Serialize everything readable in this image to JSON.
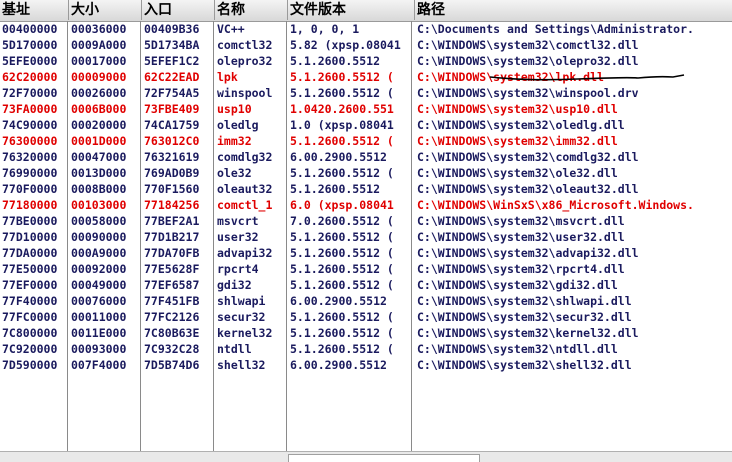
{
  "columns": {
    "base": "基址",
    "size": "大小",
    "entry": "入口",
    "name": "名称",
    "version": "文件版本",
    "path": "路径"
  },
  "modules": [
    {
      "base": "00400000",
      "size": "00036000",
      "entry": "00409B36",
      "name": "VC++",
      "version": "1, 0, 0, 1",
      "path": "C:\\Documents and Settings\\Administrator.",
      "highlight": false
    },
    {
      "base": "5D170000",
      "size": "0009A000",
      "entry": "5D1734BA",
      "name": "comctl32",
      "version": "5.82 (xpsp.08041",
      "path": "C:\\WINDOWS\\system32\\comctl32.dll",
      "highlight": false
    },
    {
      "base": "5EFE0000",
      "size": "00017000",
      "entry": "5EFEF1C2",
      "name": "olepro32",
      "version": "5.1.2600.5512",
      "path": "C:\\WINDOWS\\system32\\olepro32.dll",
      "highlight": false
    },
    {
      "base": "62C20000",
      "size": "00009000",
      "entry": "62C22EAD",
      "name": "lpk",
      "version": "5.1.2600.5512 (",
      "path": "C:\\WINDOWS\\system32\\lpk.dll",
      "highlight": true
    },
    {
      "base": "72F70000",
      "size": "00026000",
      "entry": "72F754A5",
      "name": "winspool",
      "version": "5.1.2600.5512 (",
      "path": "C:\\WINDOWS\\system32\\winspool.drv",
      "highlight": false
    },
    {
      "base": "73FA0000",
      "size": "0006B000",
      "entry": "73FBE409",
      "name": "usp10",
      "version": "1.0420.2600.551",
      "path": "C:\\WINDOWS\\system32\\usp10.dll",
      "highlight": true
    },
    {
      "base": "74C90000",
      "size": "00020000",
      "entry": "74CA1759",
      "name": "oledlg",
      "version": "1.0 (xpsp.08041",
      "path": "C:\\WINDOWS\\system32\\oledlg.dll",
      "highlight": false
    },
    {
      "base": "76300000",
      "size": "0001D000",
      "entry": "763012C0",
      "name": "imm32",
      "version": "5.1.2600.5512 (",
      "path": "C:\\WINDOWS\\system32\\imm32.dll",
      "highlight": true
    },
    {
      "base": "76320000",
      "size": "00047000",
      "entry": "76321619",
      "name": "comdlg32",
      "version": "6.00.2900.5512",
      "path": "C:\\WINDOWS\\system32\\comdlg32.dll",
      "highlight": false
    },
    {
      "base": "76990000",
      "size": "0013D000",
      "entry": "769AD0B9",
      "name": "ole32",
      "version": "5.1.2600.5512 (",
      "path": "C:\\WINDOWS\\system32\\ole32.dll",
      "highlight": false
    },
    {
      "base": "770F0000",
      "size": "0008B000",
      "entry": "770F1560",
      "name": "oleaut32",
      "version": "5.1.2600.5512",
      "path": "C:\\WINDOWS\\system32\\oleaut32.dll",
      "highlight": false
    },
    {
      "base": "77180000",
      "size": "00103000",
      "entry": "77184256",
      "name": "comctl_1",
      "version": "6.0 (xpsp.08041",
      "path": "C:\\WINDOWS\\WinSxS\\x86_Microsoft.Windows.",
      "highlight": true
    },
    {
      "base": "77BE0000",
      "size": "00058000",
      "entry": "77BEF2A1",
      "name": "msvcrt",
      "version": "7.0.2600.5512 (",
      "path": "C:\\WINDOWS\\system32\\msvcrt.dll",
      "highlight": false
    },
    {
      "base": "77D10000",
      "size": "00090000",
      "entry": "77D1B217",
      "name": "user32",
      "version": "5.1.2600.5512 (",
      "path": "C:\\WINDOWS\\system32\\user32.dll",
      "highlight": false
    },
    {
      "base": "77DA0000",
      "size": "000A9000",
      "entry": "77DA70FB",
      "name": "advapi32",
      "version": "5.1.2600.5512 (",
      "path": "C:\\WINDOWS\\system32\\advapi32.dll",
      "highlight": false
    },
    {
      "base": "77E50000",
      "size": "00092000",
      "entry": "77E5628F",
      "name": "rpcrt4",
      "version": "5.1.2600.5512 (",
      "path": "C:\\WINDOWS\\system32\\rpcrt4.dll",
      "highlight": false
    },
    {
      "base": "77EF0000",
      "size": "00049000",
      "entry": "77EF6587",
      "name": "gdi32",
      "version": "5.1.2600.5512 (",
      "path": "C:\\WINDOWS\\system32\\gdi32.dll",
      "highlight": false
    },
    {
      "base": "77F40000",
      "size": "00076000",
      "entry": "77F451FB",
      "name": "shlwapi",
      "version": "6.00.2900.5512",
      "path": "C:\\WINDOWS\\system32\\shlwapi.dll",
      "highlight": false
    },
    {
      "base": "77FC0000",
      "size": "00011000",
      "entry": "77FC2126",
      "name": "secur32",
      "version": "5.1.2600.5512 (",
      "path": "C:\\WINDOWS\\system32\\secur32.dll",
      "highlight": false
    },
    {
      "base": "7C800000",
      "size": "0011E000",
      "entry": "7C80B63E",
      "name": "kernel32",
      "version": "5.1.2600.5512 (",
      "path": "C:\\WINDOWS\\system32\\kernel32.dll",
      "highlight": false
    },
    {
      "base": "7C920000",
      "size": "00093000",
      "entry": "7C932C28",
      "name": "ntdll",
      "version": "5.1.2600.5512 (",
      "path": "C:\\WINDOWS\\system32\\ntdll.dll",
      "highlight": false
    },
    {
      "base": "7D590000",
      "size": "007F4000",
      "entry": "7D5B74D6",
      "name": "shell32",
      "version": "6.00.2900.5512",
      "path": "C:\\WINDOWS\\system32\\shell32.dll",
      "highlight": false
    }
  ],
  "colors": {
    "normal_text": "#1a1a5e",
    "highlight_text": "#e00000"
  }
}
